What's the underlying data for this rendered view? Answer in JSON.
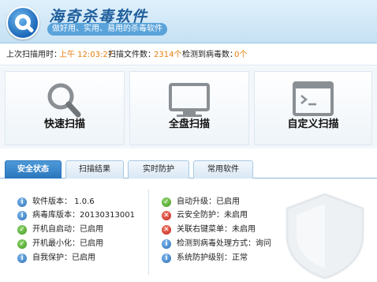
{
  "app": {
    "title": "海奇杀毒软件",
    "slogan": "做好用、实用、易用的杀毒软件"
  },
  "status": {
    "last_scan_label": "上次扫描用时：",
    "last_scan_value": "上午 12:03:27",
    "files_label": "扫描文件数：",
    "files_value": "2314个",
    "virus_label": "检测到病毒数：",
    "virus_value": "0个"
  },
  "scan_buttons": [
    {
      "label": "快速扫描",
      "icon": "magnifier-icon"
    },
    {
      "label": "全盘扫描",
      "icon": "monitor-icon"
    },
    {
      "label": "自定义扫描",
      "icon": "terminal-window-icon"
    }
  ],
  "tabs": [
    {
      "label": "安全状态",
      "active": true
    },
    {
      "label": "扫描结果",
      "active": false
    },
    {
      "label": "实时防护",
      "active": false
    },
    {
      "label": "常用软件",
      "active": false
    }
  ],
  "left_items": [
    {
      "text": "软件版本：  1.0.6",
      "icon": "info-icon"
    },
    {
      "text": "病毒库版本：20130313001",
      "icon": "info-icon"
    },
    {
      "text": "开机自启动：已启用",
      "icon": "check-icon"
    },
    {
      "text": "开机最小化：已启用",
      "icon": "check-icon"
    },
    {
      "text": "自我保护：已启用",
      "icon": "info-icon"
    }
  ],
  "right_items": [
    {
      "text": "自动升级：已启用",
      "icon": "check-icon"
    },
    {
      "text": "云安全防护：未启用",
      "icon": "cross-icon"
    },
    {
      "text": "关联右键菜单：未启用",
      "icon": "cross-icon"
    },
    {
      "text": "检测到病毒处理方式：询问",
      "icon": "info-icon"
    },
    {
      "text": "系统防护级别：正常",
      "icon": "info-icon"
    }
  ],
  "colors": {
    "accent": "#2a76bd",
    "value_orange": "#e77e0f",
    "ok_green": "#3f9b1f",
    "error_red": "#c4251a"
  }
}
